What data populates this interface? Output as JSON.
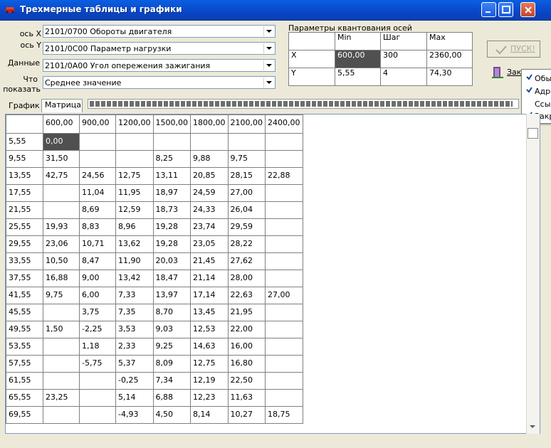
{
  "window": {
    "title": "Трехмерные таблицы и графики",
    "buttons": [
      "minimize",
      "maximize",
      "close"
    ]
  },
  "selectors": [
    {
      "label": "ось X",
      "value": "2101/0700 Обороты двигателя"
    },
    {
      "label": "ось Y",
      "value": "2101/0C00 Параметр нагрузки"
    },
    {
      "label": "Данные",
      "value": "2101/0A00 Угол опережения зажигания"
    },
    {
      "label_line1": "Что",
      "label_line2": "показать",
      "value": "Среднее значение"
    }
  ],
  "quantization": {
    "title": "Параметры квантования осей",
    "headers": [
      "",
      "Min",
      "Шаг",
      "Max"
    ],
    "rows": [
      [
        "X",
        "600,00",
        "300",
        "2360,00"
      ],
      [
        "Y",
        "5,55",
        "4",
        "74,30"
      ]
    ]
  },
  "buttons": {
    "pusk": "ПУСК!",
    "zak": "Зак"
  },
  "context_menu": [
    {
      "checked": true,
      "label": "Обычн"
    },
    {
      "checked": true,
      "label": "Адрес"
    },
    {
      "checked": false,
      "label": "Ссылк"
    },
    {
      "checked": true,
      "label": "Закре"
    }
  ],
  "tabs": [
    {
      "label": "График",
      "active": false
    },
    {
      "label": "Матрица",
      "active": true
    }
  ],
  "progress": 0.99,
  "matrix": {
    "columns": [
      "600,00",
      "900,00",
      "1200,00",
      "1500,00",
      "1800,00",
      "2100,00",
      "2400,00"
    ],
    "rows": [
      {
        "y": "5,55",
        "cells": [
          "0,00",
          "",
          "",
          "",
          "",
          "",
          ""
        ]
      },
      {
        "y": "9,55",
        "cells": [
          "31,50",
          "",
          "",
          "8,25",
          "9,88",
          "9,75",
          ""
        ]
      },
      {
        "y": "13,55",
        "cells": [
          "42,75",
          "24,56",
          "12,75",
          "13,11",
          "20,85",
          "28,15",
          "22,88"
        ]
      },
      {
        "y": "17,55",
        "cells": [
          "",
          "11,04",
          "11,95",
          "18,97",
          "24,59",
          "27,00",
          ""
        ]
      },
      {
        "y": "21,55",
        "cells": [
          "",
          "8,69",
          "12,59",
          "18,73",
          "24,33",
          "26,04",
          ""
        ]
      },
      {
        "y": "25,55",
        "cells": [
          "19,93",
          "8,83",
          "8,96",
          "19,28",
          "23,74",
          "29,59",
          ""
        ]
      },
      {
        "y": "29,55",
        "cells": [
          "23,06",
          "10,71",
          "13,62",
          "19,28",
          "23,05",
          "28,22",
          ""
        ]
      },
      {
        "y": "33,55",
        "cells": [
          "10,50",
          "8,47",
          "11,90",
          "20,03",
          "21,45",
          "27,62",
          ""
        ]
      },
      {
        "y": "37,55",
        "cells": [
          "16,88",
          "9,00",
          "13,42",
          "18,47",
          "21,14",
          "28,00",
          ""
        ]
      },
      {
        "y": "41,55",
        "cells": [
          "9,75",
          "6,00",
          "7,33",
          "13,97",
          "17,14",
          "22,63",
          "27,00"
        ]
      },
      {
        "y": "45,55",
        "cells": [
          "",
          "3,75",
          "7,35",
          "8,70",
          "13,45",
          "21,95",
          ""
        ]
      },
      {
        "y": "49,55",
        "cells": [
          "1,50",
          "-2,25",
          "3,53",
          "9,03",
          "12,53",
          "22,00",
          ""
        ]
      },
      {
        "y": "53,55",
        "cells": [
          "",
          "1,18",
          "2,33",
          "9,25",
          "14,63",
          "16,00",
          ""
        ]
      },
      {
        "y": "57,55",
        "cells": [
          "",
          "-5,75",
          "5,37",
          "8,09",
          "12,75",
          "16,80",
          ""
        ]
      },
      {
        "y": "61,55",
        "cells": [
          "",
          "",
          "-0,25",
          "7,34",
          "12,19",
          "22,50",
          ""
        ]
      },
      {
        "y": "65,55",
        "cells": [
          "23,25",
          "",
          "5,14",
          "6,88",
          "12,23",
          "11,63",
          ""
        ]
      },
      {
        "y": "69,55",
        "cells": [
          "",
          "",
          "-4,93",
          "4,50",
          "8,14",
          "10,27",
          "18,75"
        ]
      }
    ]
  }
}
